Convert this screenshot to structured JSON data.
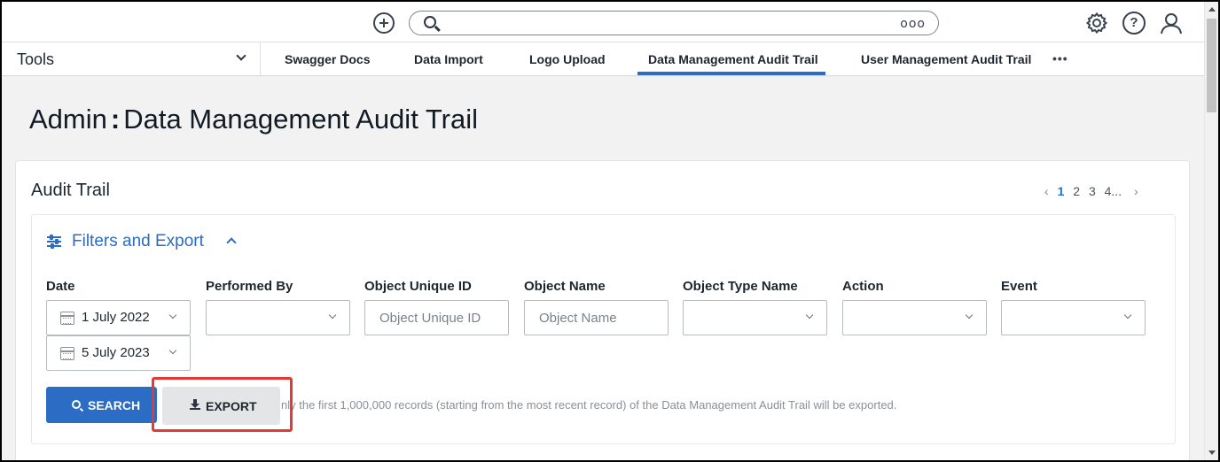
{
  "topbar": {
    "add_icon": "plus-circle-icon",
    "search": {
      "placeholder": "",
      "more": "ooo"
    },
    "help_icon": "?"
  },
  "nav": {
    "tools_label": "Tools",
    "tabs": [
      {
        "label": "Swagger Docs"
      },
      {
        "label": "Data Import"
      },
      {
        "label": "Logo Upload"
      },
      {
        "label": "Data Management Audit Trail",
        "active": true
      },
      {
        "label": "User Management Audit Trail"
      }
    ],
    "more": "•••"
  },
  "page": {
    "title_prefix": "Admin",
    "title_sep": ":",
    "title_main": "Data Management Audit Trail"
  },
  "card": {
    "title": "Audit Trail",
    "pagination": {
      "prev": "‹",
      "pages": [
        "1",
        "2",
        "3",
        "4"
      ],
      "current": "1",
      "ellipsis": "...",
      "next": "›"
    },
    "filters": {
      "toggle_label": "Filters and Export",
      "fields": {
        "date": {
          "label": "Date",
          "from": "1 July 2022",
          "to": "5 July 2023"
        },
        "performed_by": {
          "label": "Performed By",
          "value": ""
        },
        "object_unique_id": {
          "label": "Object Unique ID",
          "placeholder": "Object Unique ID"
        },
        "object_name": {
          "label": "Object Name",
          "placeholder": "Object Name"
        },
        "object_type_name": {
          "label": "Object Type Name",
          "value": ""
        },
        "action": {
          "label": "Action",
          "value": ""
        },
        "event": {
          "label": "Event",
          "value": ""
        }
      },
      "search_button": "SEARCH",
      "export_button": "EXPORT",
      "export_note": "nly the first 1,000,000 records (starting from the most recent record) of the Data Management Audit Trail will be exported."
    }
  },
  "colors": {
    "accent": "#2b6cc4",
    "highlight": "#e53935",
    "page_bg": "#f2f2f2"
  }
}
